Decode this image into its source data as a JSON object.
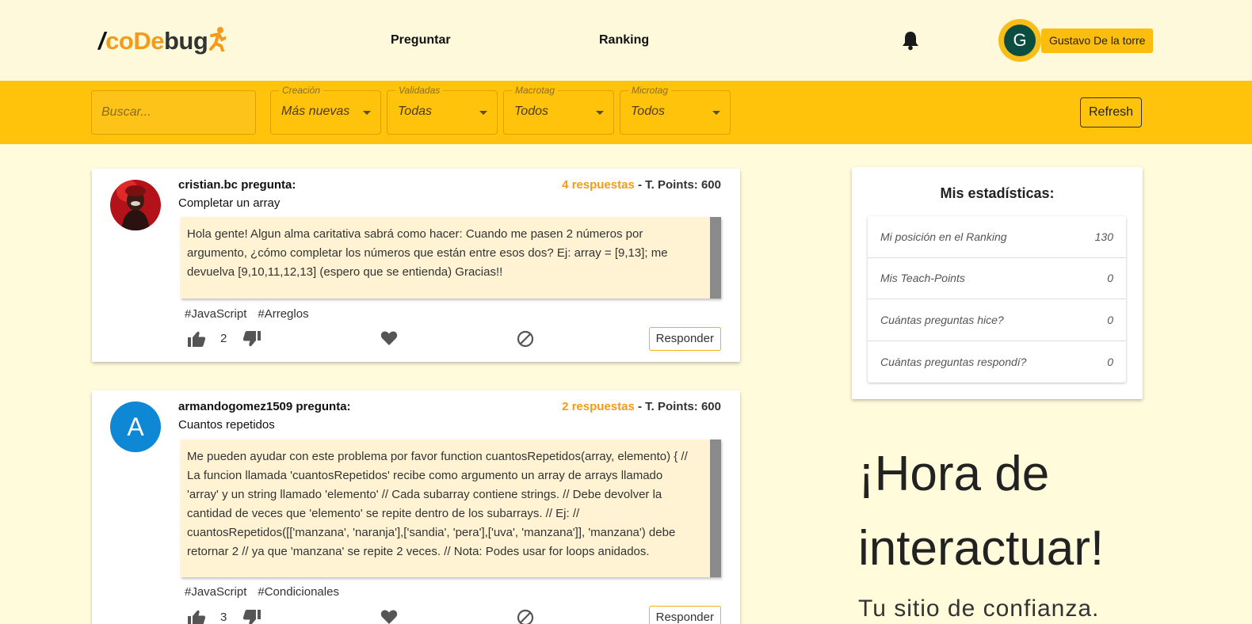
{
  "header": {
    "logo": {
      "slash": "/",
      "co": "co",
      "de": "De",
      "bug": "bug"
    },
    "nav": {
      "ask": "Preguntar",
      "ranking": "Ranking"
    },
    "user": {
      "initial": "G",
      "name": "Gustavo De la torre"
    }
  },
  "filters": {
    "search_placeholder": "Buscar...",
    "creation": {
      "legend": "Creación",
      "value": "Más nuevas"
    },
    "validated": {
      "legend": "Validadas",
      "value": "Todas"
    },
    "macrotag": {
      "legend": "Macrotag",
      "value": "Todos"
    },
    "microtag": {
      "legend": "Microtag",
      "value": "Todos"
    },
    "refresh_label": "Refresh"
  },
  "questions": [
    {
      "author": "cristian.bc pregunta:",
      "title": "Completar un array",
      "answers": "4 respuestas",
      "points": "- T. Points: 600",
      "body": "Hola gente! Algun alma caritativa sabrá como hacer: Cuando me pasen 2 números por argumento, ¿cómo completar los números que están entre esos dos? Ej: array = [9,13]; me devuelva [9,10,11,12,13] (espero que se entienda) Gracias!!",
      "tags": [
        "#JavaScript",
        "#Arreglos"
      ],
      "likes": "2",
      "respond_label": "Responder"
    },
    {
      "author": "armandogomez1509 pregunta:",
      "title": "Cuantos repetidos",
      "avatar_initial": "A",
      "answers": "2 respuestas",
      "points": "- T. Points: 600",
      "body": "Me pueden ayudar con este problema por favor function cuantosRepetidos(array, elemento) { // La funcion llamada 'cuantosRepetidos' recibe como argumento un array de arrays llamado 'array' y un string llamado 'elemento' // Cada subarray contiene strings. // Debe devolver la cantidad de veces que 'elemento' se repite dentro de los subarrays. // Ej: // cuantosRepetidos([['manzana', 'naranja'],['sandia', 'pera'],['uva', 'manzana']], 'manzana') debe retornar 2 // ya que 'manzana' se repite 2 veces. // Nota: Podes usar for loops anidados.",
      "tags": [
        "#JavaScript",
        "#Condicionales"
      ],
      "likes": "3",
      "respond_label": "Responder"
    }
  ],
  "stats": {
    "title": "Mis estadísticas:",
    "rows": [
      {
        "label": "Mi posición en el Ranking",
        "value": "130"
      },
      {
        "label": "Mis Teach-Points",
        "value": "0"
      },
      {
        "label": "Cuántas preguntas hice?",
        "value": "0"
      },
      {
        "label": "Cuántas preguntas respondí?",
        "value": "0"
      }
    ]
  },
  "hero": {
    "line1": "¡Hora de",
    "line2": "interactuar!",
    "subtitle": "Tu sitio de confianza."
  },
  "colors": {
    "accent": "#fec30a",
    "page_bg": "#fffbdb",
    "answers": "#f49a18"
  }
}
